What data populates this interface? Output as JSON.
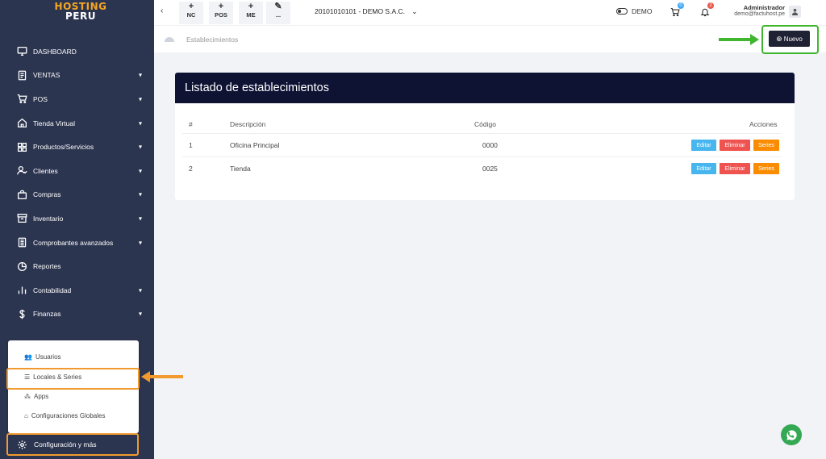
{
  "logo": {
    "line1": "HOSTING",
    "line2": "PERU"
  },
  "sidebar": {
    "items": [
      {
        "label": "DASHBOARD",
        "icon": "monitor-icon",
        "has_chevron": false
      },
      {
        "label": "VENTAS",
        "icon": "document-icon",
        "has_chevron": true
      },
      {
        "label": "POS",
        "icon": "cart-icon",
        "has_chevron": true
      },
      {
        "label": "Tienda Virtual",
        "icon": "home-icon",
        "has_chevron": true
      },
      {
        "label": "Productos/Servicios",
        "icon": "grid-icon",
        "has_chevron": true
      },
      {
        "label": "Clientes",
        "icon": "user-icon",
        "has_chevron": true
      },
      {
        "label": "Compras",
        "icon": "bag-icon",
        "has_chevron": true
      },
      {
        "label": "Inventario",
        "icon": "archive-icon",
        "has_chevron": true
      },
      {
        "label": "Comprobantes avanzados",
        "icon": "file-icon",
        "has_chevron": true
      },
      {
        "label": "Reportes",
        "icon": "pie-chart-icon",
        "has_chevron": false
      },
      {
        "label": "Contabilidad",
        "icon": "bar-chart-icon",
        "has_chevron": true
      },
      {
        "label": "Finanzas",
        "icon": "dollar-icon",
        "has_chevron": true
      }
    ],
    "submenu": [
      {
        "label": "Usuarios",
        "icon": "users-icon"
      },
      {
        "label": "Locales & Series",
        "icon": "list-icon"
      },
      {
        "label": "Apps",
        "icon": "apps-icon"
      },
      {
        "label": "Configuraciones Globales",
        "icon": "building-icon"
      }
    ],
    "config_label": "Configuración y más"
  },
  "topbar": {
    "quick_buttons": [
      {
        "symbol": "+",
        "label": "NC"
      },
      {
        "symbol": "+",
        "label": "POS"
      },
      {
        "symbol": "+",
        "label": "ME"
      },
      {
        "symbol": "✎",
        "label": "..."
      }
    ],
    "company": "20101010101 - DEMO S.A.C.",
    "demo_label": "DEMO",
    "cart_count": "0",
    "notif_count": "2",
    "user_name": "Administrador",
    "user_email": "demo@factuhost.pe"
  },
  "breadcrumb": {
    "label": "Establecimientos"
  },
  "new_button": {
    "label": "Nuevo"
  },
  "card": {
    "title": "Listado de establecimientos",
    "columns": [
      "#",
      "Descripción",
      "Código",
      "Acciones"
    ],
    "rows": [
      {
        "num": "1",
        "description": "Oficina Principal",
        "code": "0000"
      },
      {
        "num": "2",
        "description": "Tienda",
        "code": "0025"
      }
    ],
    "actions": {
      "edit": "Editar",
      "delete": "Eliminar",
      "series": "Series"
    }
  },
  "colors": {
    "sidebar_bg": "#2c3550",
    "card_header_bg": "#0e1233",
    "highlight_orange": "#f29a2e",
    "highlight_green": "#3fb62e",
    "edit": "#47b5ee",
    "delete": "#ef5350",
    "series": "#fb8c00"
  }
}
